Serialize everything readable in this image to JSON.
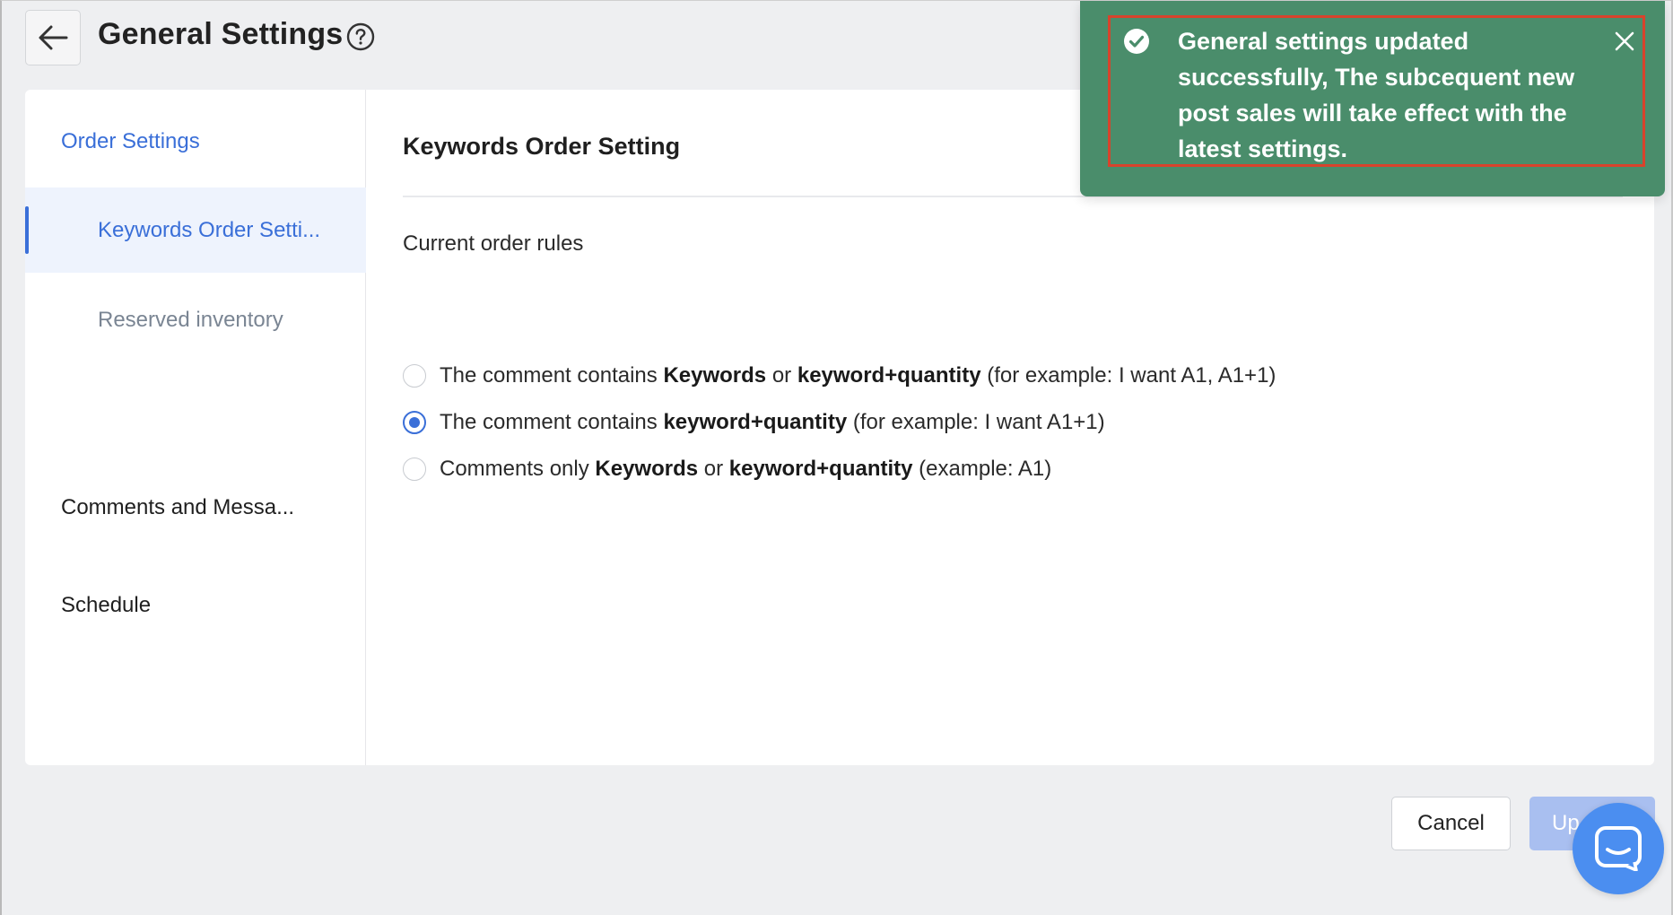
{
  "header": {
    "title": "General Settings",
    "back_icon": "arrow-left-icon",
    "help_icon": "question-circle-icon"
  },
  "sidebar": {
    "items": [
      {
        "label": "Order Settings"
      },
      {
        "label": "Keywords Order Setti..."
      },
      {
        "label": "Reserved inventory"
      },
      {
        "label": "Comments and Messa..."
      },
      {
        "label": "Schedule"
      }
    ],
    "active_index": 1
  },
  "content": {
    "section_title": "Keywords Order Setting",
    "rules_label": "Current order rules",
    "options": [
      {
        "t1": "The comment contains ",
        "b1": "Keywords",
        "t2": " or ",
        "b2": "keyword+quantity",
        "t3": " (for example: I want A1, A1+1)",
        "selected": false
      },
      {
        "t1": "The comment contains ",
        "b1": "keyword+quantity",
        "t2": " (for example: I want A1+1)",
        "b2": "",
        "t3": "",
        "selected": true
      },
      {
        "t1": "Comments only ",
        "b1": "Keywords",
        "t2": " or ",
        "b2": "keyword+quantity",
        "t3": " (example: A1)",
        "selected": false
      }
    ]
  },
  "footer": {
    "cancel_label": "Cancel",
    "update_label": "Up"
  },
  "toast": {
    "message": "General settings updated successfully, The subcequent new post sales will take effect with the latest settings.",
    "icon": "check-circle-icon",
    "close_icon": "close-icon"
  },
  "chat": {
    "icon": "chat-icon"
  },
  "colors": {
    "accent": "#3a6fd8",
    "toast_bg": "#4a8d6b",
    "highlight": "#d8432c",
    "update_disabled": "#a9bff0",
    "chat": "#4b8ef0"
  }
}
